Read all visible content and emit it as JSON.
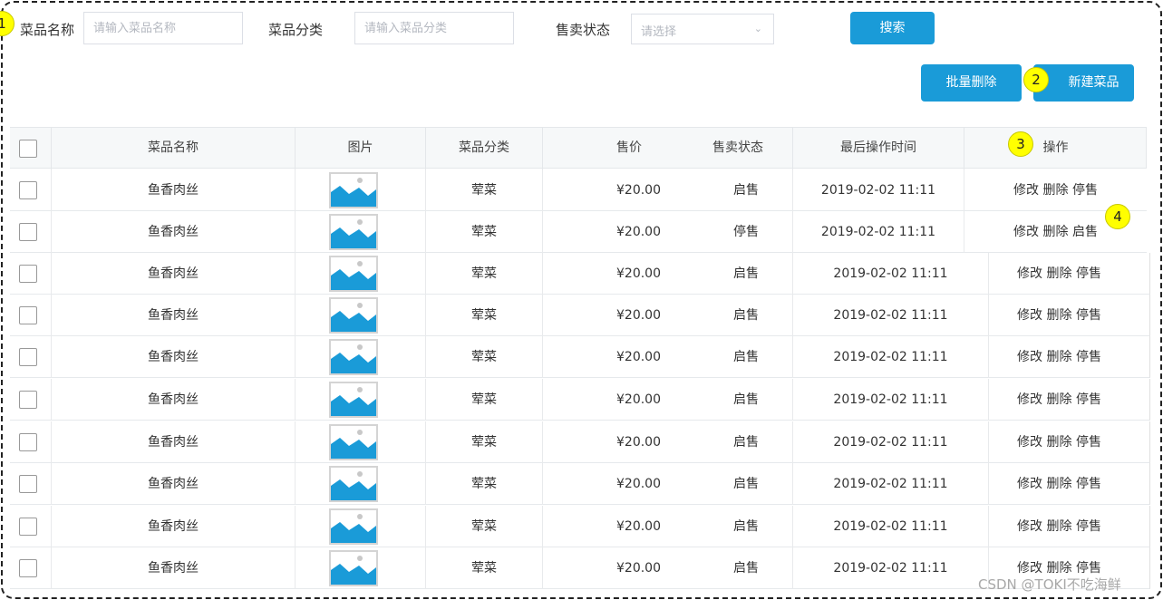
{
  "filters": {
    "name_label": "菜品名称",
    "name_placeholder": "请输入菜品名称",
    "category_label": "菜品分类",
    "category_placeholder": "请输入菜品分类",
    "status_label": "售卖状态",
    "status_placeholder": "请选择",
    "search_button": "搜索"
  },
  "actions": {
    "batch_delete": "批量删除",
    "new_dish": "新建菜品"
  },
  "badges": [
    "1",
    "2",
    "3",
    "4"
  ],
  "table": {
    "columns": [
      "菜品名称",
      "图片",
      "菜品分类",
      "售价",
      "售卖状态",
      "最后操作时间",
      "操作"
    ],
    "op_labels": {
      "edit": "修改",
      "delete": "删除"
    },
    "rows": [
      {
        "name": "鱼香肉丝",
        "category": "荤菜",
        "price": "¥20.00",
        "status": "启售",
        "time": "2019-02-02 11:11",
        "toggle": "停售"
      },
      {
        "name": "鱼香肉丝",
        "category": "荤菜",
        "price": "¥20.00",
        "status": "停售",
        "time": "2019-02-02 11:11",
        "toggle": "启售"
      },
      {
        "name": "鱼香肉丝",
        "category": "荤菜",
        "price": "¥20.00",
        "status": "启售",
        "time": "2019-02-02 11:11",
        "toggle": "停售"
      },
      {
        "name": "鱼香肉丝",
        "category": "荤菜",
        "price": "¥20.00",
        "status": "启售",
        "time": "2019-02-02 11:11",
        "toggle": "停售"
      },
      {
        "name": "鱼香肉丝",
        "category": "荤菜",
        "price": "¥20.00",
        "status": "启售",
        "time": "2019-02-02 11:11",
        "toggle": "停售"
      },
      {
        "name": "鱼香肉丝",
        "category": "荤菜",
        "price": "¥20.00",
        "status": "启售",
        "time": "2019-02-02 11:11",
        "toggle": "停售"
      },
      {
        "name": "鱼香肉丝",
        "category": "荤菜",
        "price": "¥20.00",
        "status": "启售",
        "time": "2019-02-02 11:11",
        "toggle": "停售"
      },
      {
        "name": "鱼香肉丝",
        "category": "荤菜",
        "price": "¥20.00",
        "status": "启售",
        "time": "2019-02-02 11:11",
        "toggle": "停售"
      },
      {
        "name": "鱼香肉丝",
        "category": "荤菜",
        "price": "¥20.00",
        "status": "启售",
        "time": "2019-02-02 11:11",
        "toggle": "停售"
      },
      {
        "name": "鱼香肉丝",
        "category": "荤菜",
        "price": "¥20.00",
        "status": "启售",
        "time": "2019-02-02 11:11",
        "toggle": "停售"
      }
    ]
  },
  "colors": {
    "primary": "#1a9bd8",
    "badge": "#ffff00"
  },
  "watermark": "CSDN @TOKI不吃海鲜"
}
